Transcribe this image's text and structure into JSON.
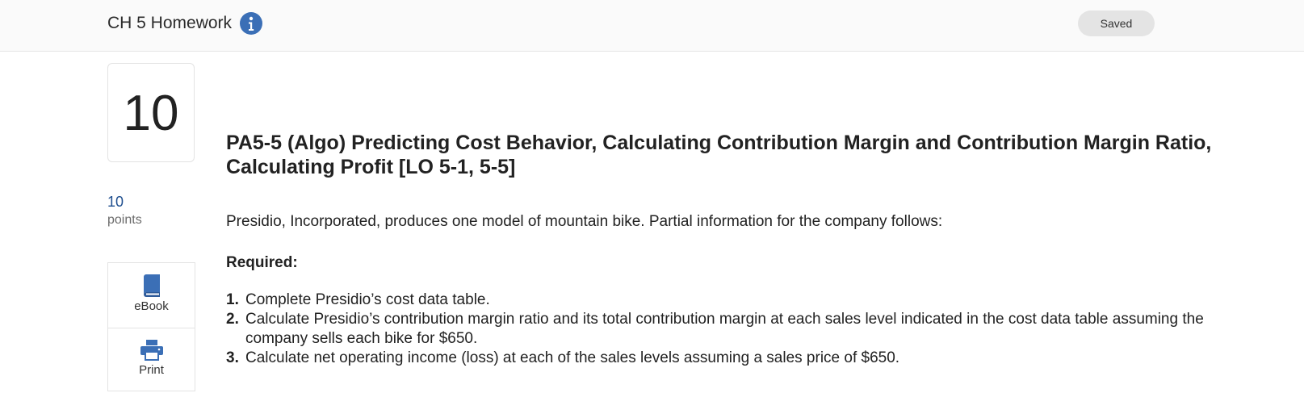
{
  "header": {
    "assignment_title": "CH 5 Homework",
    "status": "Saved"
  },
  "question": {
    "number": "10",
    "points_value": "10",
    "points_label": "points",
    "title": "PA5-5 (Algo) Predicting Cost Behavior, Calculating Contribution Margin and Contribution Margin Ratio, Calculating Profit [LO 5-1, 5-5]",
    "intro": "Presidio, Incorporated, produces one model of mountain bike. Partial information for the company follows:",
    "required_label": "Required:",
    "requirements": [
      {
        "num": "1.",
        "text": "Complete Presidio’s cost data table."
      },
      {
        "num": "2.",
        "text": "Calculate Presidio’s contribution margin ratio and its total contribution margin at each sales level indicated in the cost data table assuming the company sells each bike for $650."
      },
      {
        "num": "3.",
        "text": "Calculate net operating income (loss) at each of the sales levels assuming a sales price of $650."
      }
    ]
  },
  "tools": [
    {
      "label": "eBook",
      "icon": "book-icon"
    },
    {
      "label": "Print",
      "icon": "printer-icon"
    }
  ],
  "colors": {
    "accent": "#3b6fb6",
    "points_value": "#1f4f8f",
    "badge_bg": "#e4e4e4"
  }
}
